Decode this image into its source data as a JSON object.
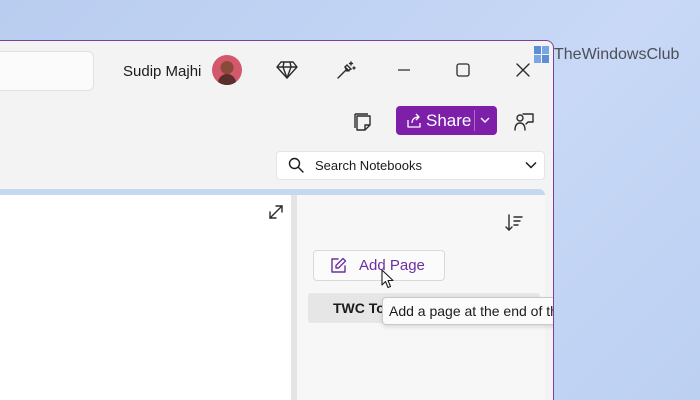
{
  "titlebar": {
    "user_name": "Sudip Majhi"
  },
  "toolbar": {
    "share_label": "Share"
  },
  "search": {
    "placeholder": "Search Notebooks"
  },
  "pages": {
    "add_page_label": "Add Page",
    "items": [
      {
        "title": "TWC To"
      }
    ],
    "tooltip": "Add a page at the end of the section"
  },
  "watermark": {
    "text": "TheWindowsClub"
  },
  "icons": {
    "premium": "diamond-icon",
    "designer": "magic-wand-icon",
    "minimize": "minimize-icon",
    "maximize": "maximize-icon",
    "close": "close-icon",
    "sticky_notes": "sticky-note-icon",
    "share": "share-icon",
    "feedback": "feedback-icon",
    "search": "search-icon",
    "expand": "expand-icon",
    "add_page": "new-page-icon",
    "sort": "sort-icon"
  },
  "colors": {
    "accent": "#7d1fa8",
    "window_border": "#7e3f9e",
    "add_page_text": "#6b2fa0",
    "desktop_bg": "#c2d4f4"
  }
}
